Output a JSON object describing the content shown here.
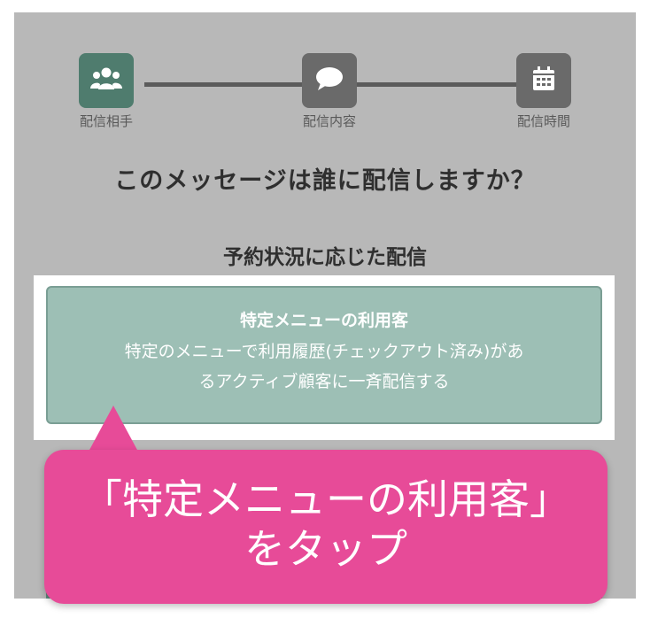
{
  "stepper": {
    "steps": [
      {
        "label": "配信相手",
        "icon": "users-icon",
        "active": true
      },
      {
        "label": "配信内容",
        "icon": "chat-bubble-icon",
        "active": false
      },
      {
        "label": "配信時間",
        "icon": "calendar-icon",
        "active": false
      }
    ]
  },
  "question": "このメッセージは誰に配信しますか？",
  "section_title": "予約状況に応じた配信",
  "option": {
    "title": "特定メニューの利用客",
    "description_line1": "特定のメニューで利用履歴(チェックアウト済み)があ",
    "description_line2": "るアクティブ顧客に一斉配信する"
  },
  "callout": {
    "line1": "「特定メニューの利用客」",
    "line2": "をタップ"
  },
  "colors": {
    "background": "#b8b8b8",
    "step_active": "#4f7c6e",
    "step_inactive": "#6a6a6a",
    "option_card": "#9dbfb5",
    "callout": "#e74b98"
  }
}
